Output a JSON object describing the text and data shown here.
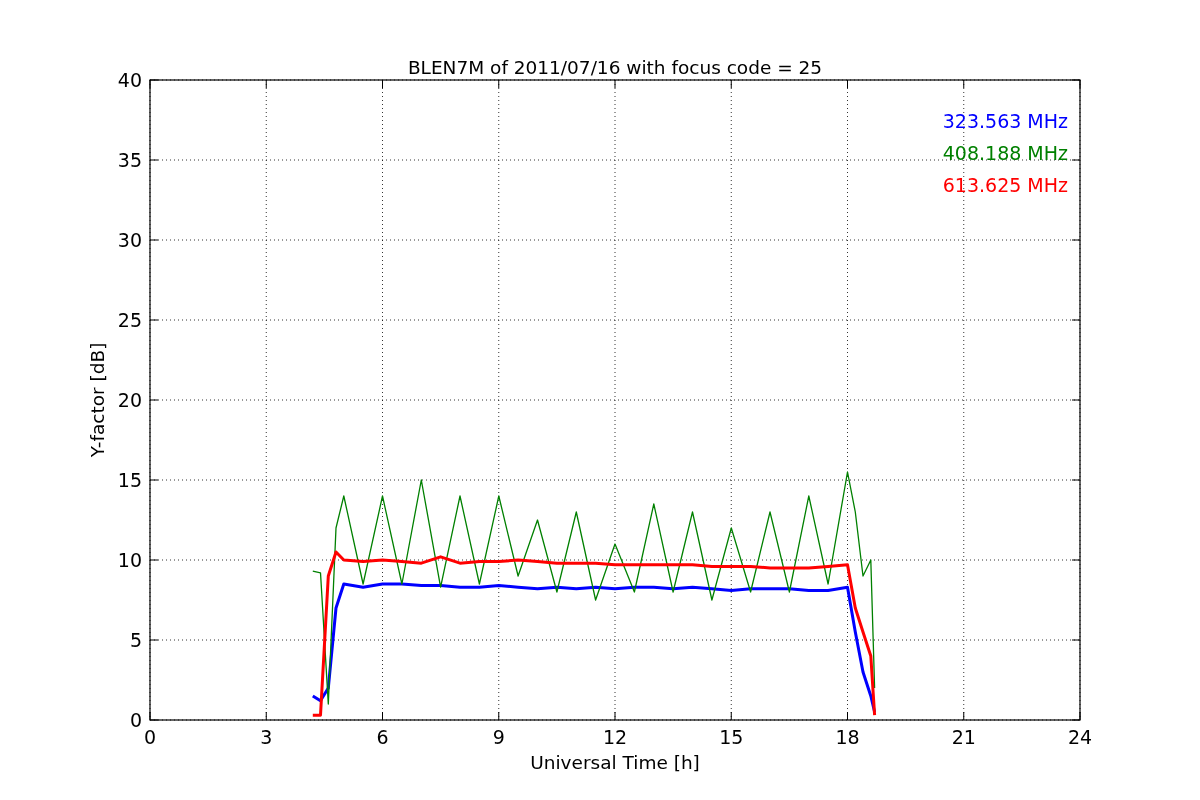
{
  "figure": {
    "chart_data": {
      "type": "line",
      "title": "BLEN7M of 2011/07/16 with focus code = 25",
      "xlabel": "Universal Time [h]",
      "ylabel": "Y-factor [dB]",
      "x": [
        4.2,
        4.4,
        4.6,
        4.8,
        5.0,
        5.5,
        6.0,
        6.5,
        7.0,
        7.5,
        8.0,
        8.5,
        9.0,
        9.5,
        10.0,
        10.5,
        11.0,
        11.5,
        12.0,
        12.5,
        13.0,
        13.5,
        14.0,
        14.5,
        15.0,
        15.5,
        16.0,
        16.5,
        17.0,
        17.5,
        18.0,
        18.2,
        18.4,
        18.6,
        18.7
      ],
      "series": [
        {
          "name": "323.563 MHz",
          "color": "#0000ff",
          "values": [
            1.5,
            1.2,
            2,
            7,
            8.5,
            8.3,
            8.5,
            8.5,
            8.4,
            8.4,
            8.3,
            8.3,
            8.4,
            8.3,
            8.2,
            8.3,
            8.2,
            8.3,
            8.2,
            8.3,
            8.3,
            8.2,
            8.3,
            8.2,
            8.1,
            8.2,
            8.2,
            8.2,
            8.1,
            8.1,
            8.3,
            5.5,
            3,
            1.5,
            0.5
          ]
        },
        {
          "name": "408.188 MHz",
          "color": "#008000",
          "values": [
            9.3,
            9.2,
            1,
            12,
            14,
            8.5,
            14,
            8.5,
            15,
            8.3,
            14,
            8.5,
            14,
            9,
            12.5,
            8,
            13,
            7.5,
            11,
            8,
            13.5,
            8,
            13,
            7.5,
            12,
            8,
            13,
            8,
            14,
            8.5,
            15.5,
            13,
            9,
            10,
            2
          ]
        },
        {
          "name": "613.625 MHz",
          "color": "#ff0000",
          "values": [
            0.3,
            0.3,
            9,
            10.5,
            10,
            9.9,
            10,
            9.9,
            9.8,
            10.2,
            9.8,
            9.9,
            9.9,
            10,
            9.9,
            9.8,
            9.8,
            9.8,
            9.7,
            9.7,
            9.7,
            9.7,
            9.7,
            9.6,
            9.6,
            9.6,
            9.5,
            9.5,
            9.5,
            9.6,
            9.7,
            7,
            5.5,
            4,
            0.3
          ]
        }
      ],
      "xlim": [
        0,
        24
      ],
      "ylim": [
        0,
        40
      ],
      "xticks": [
        0,
        3,
        6,
        9,
        12,
        15,
        18,
        21,
        24
      ],
      "yticks": [
        0,
        5,
        10,
        15,
        20,
        25,
        30,
        35,
        40
      ],
      "grid": true
    }
  }
}
